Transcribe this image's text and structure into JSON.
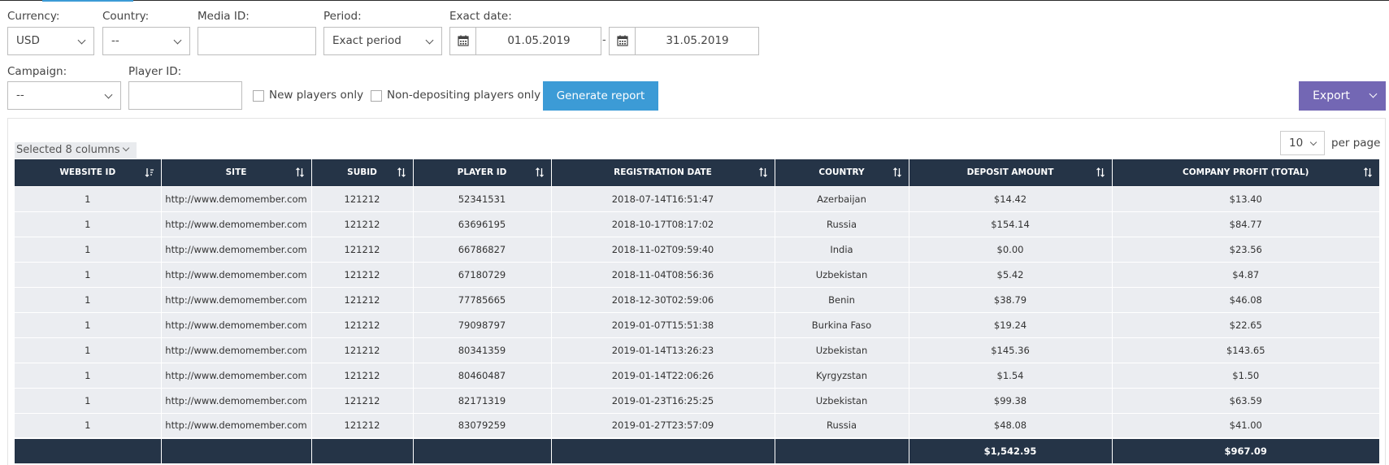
{
  "filters": {
    "currency": {
      "label": "Currency:",
      "value": "USD"
    },
    "country": {
      "label": "Country:",
      "value": "--"
    },
    "media_id": {
      "label": "Media ID:",
      "value": ""
    },
    "period": {
      "label": "Period:",
      "value": "Exact period"
    },
    "exact_date": {
      "label": "Exact date:",
      "from": "01.05.2019",
      "to": "31.05.2019",
      "separator": "-"
    },
    "campaign": {
      "label": "Campaign:",
      "value": "--"
    },
    "player_id": {
      "label": "Player ID:",
      "value": ""
    },
    "new_players_only": {
      "label": "New players only",
      "checked": false
    },
    "non_depositing_only": {
      "label": "Non-depositing players only",
      "checked": false
    }
  },
  "actions": {
    "generate_label": "Generate report",
    "export_label": "Export"
  },
  "table_controls": {
    "columns_selected": "Selected 8 columns",
    "per_page_value": "10",
    "per_page_label": "per page"
  },
  "table": {
    "headers": [
      "WEBSITE ID",
      "SITE",
      "SUBID",
      "PLAYER ID",
      "REGISTRATION DATE",
      "COUNTRY",
      "DEPOSIT AMOUNT",
      "COMPANY PROFIT (TOTAL)"
    ],
    "rows": [
      [
        "1",
        "http://www.demomember.com",
        "121212",
        "52341531",
        "2018-07-14T16:51:47",
        "Azerbaijan",
        "$14.42",
        "$13.40"
      ],
      [
        "1",
        "http://www.demomember.com",
        "121212",
        "63696195",
        "2018-10-17T08:17:02",
        "Russia",
        "$154.14",
        "$84.77"
      ],
      [
        "1",
        "http://www.demomember.com",
        "121212",
        "66786827",
        "2018-11-02T09:59:40",
        "India",
        "$0.00",
        "$23.56"
      ],
      [
        "1",
        "http://www.demomember.com",
        "121212",
        "67180729",
        "2018-11-04T08:56:36",
        "Uzbekistan",
        "$5.42",
        "$4.87"
      ],
      [
        "1",
        "http://www.demomember.com",
        "121212",
        "77785665",
        "2018-12-30T02:59:06",
        "Benin",
        "$38.79",
        "$46.08"
      ],
      [
        "1",
        "http://www.demomember.com",
        "121212",
        "79098797",
        "2019-01-07T15:51:38",
        "Burkina Faso",
        "$19.24",
        "$22.65"
      ],
      [
        "1",
        "http://www.demomember.com",
        "121212",
        "80341359",
        "2019-01-14T13:26:23",
        "Uzbekistan",
        "$145.36",
        "$143.65"
      ],
      [
        "1",
        "http://www.demomember.com",
        "121212",
        "80460487",
        "2019-01-14T22:06:26",
        "Kyrgyzstan",
        "$1.54",
        "$1.50"
      ],
      [
        "1",
        "http://www.demomember.com",
        "121212",
        "82171319",
        "2019-01-23T16:25:25",
        "Uzbekistan",
        "$99.38",
        "$63.59"
      ],
      [
        "1",
        "http://www.demomember.com",
        "121212",
        "83079259",
        "2019-01-27T23:57:09",
        "Russia",
        "$48.08",
        "$41.00"
      ]
    ],
    "totals": [
      "",
      "",
      "",
      "",
      "",
      "",
      "$1,542.95",
      "$967.09"
    ]
  },
  "colors": {
    "header_bg": "#253447",
    "row_bg": "#ebedf1",
    "generate_button": "#3c9bd6",
    "export_button": "#7367b4"
  },
  "icons": {
    "calendar": "calendar-icon",
    "sort": "sort-icon",
    "sort_active": "sort-numeric-icon",
    "dropdown": "chevron-down-icon"
  }
}
